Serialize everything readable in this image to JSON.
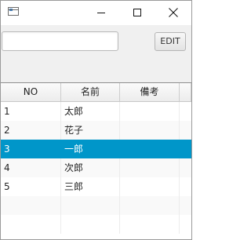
{
  "window": {
    "title_icon": "app-window-icon",
    "controls": {
      "minimize_icon": "minimize-icon",
      "maximize_icon": "maximize-icon",
      "close_icon": "close-icon"
    }
  },
  "toolbar": {
    "input_value": "",
    "edit_label": "EDIT"
  },
  "table": {
    "columns": [
      "NO",
      "名前",
      "備考"
    ],
    "rows": [
      {
        "no": "1",
        "name": "太郎",
        "note": ""
      },
      {
        "no": "2",
        "name": "花子",
        "note": ""
      },
      {
        "no": "3",
        "name": "一郎",
        "note": ""
      },
      {
        "no": "4",
        "name": "次郎",
        "note": ""
      },
      {
        "no": "5",
        "name": "三郎",
        "note": ""
      }
    ],
    "selected_row": 3
  },
  "colors": {
    "selection": "#0096c9",
    "window_bg": "#f0f0f0"
  }
}
